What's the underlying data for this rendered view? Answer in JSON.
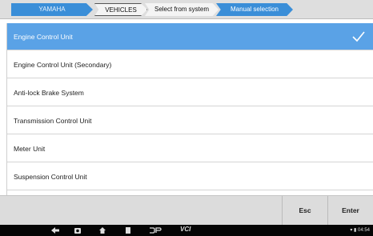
{
  "breadcrumb": [
    {
      "label": "YAMAHA",
      "active": true
    },
    {
      "label": "VEHICLES",
      "active": false
    },
    {
      "label": "Select from system",
      "active": false
    },
    {
      "label": "Manual selection",
      "active": true
    }
  ],
  "list": {
    "items": [
      {
        "label": "Engine Control Unit",
        "selected": true
      },
      {
        "label": "Engine Control Unit (Secondary)",
        "selected": false
      },
      {
        "label": "Anti-lock Brake System",
        "selected": false
      },
      {
        "label": "Transmission Control Unit",
        "selected": false
      },
      {
        "label": "Meter Unit",
        "selected": false
      },
      {
        "label": "Suspension Control Unit",
        "selected": false
      }
    ]
  },
  "actions": {
    "esc_label": "Esc",
    "enter_label": "Enter"
  },
  "navbar": {
    "icons": [
      "back-icon",
      "camera-icon",
      "home-icon",
      "recents-icon",
      "dp-icon",
      "vci-icon"
    ],
    "vci_label": "VCI",
    "status_text": "▾ ▮ 04:54"
  },
  "colors": {
    "accent": "#3a8ed8",
    "selected_row": "#5aa2e6"
  }
}
